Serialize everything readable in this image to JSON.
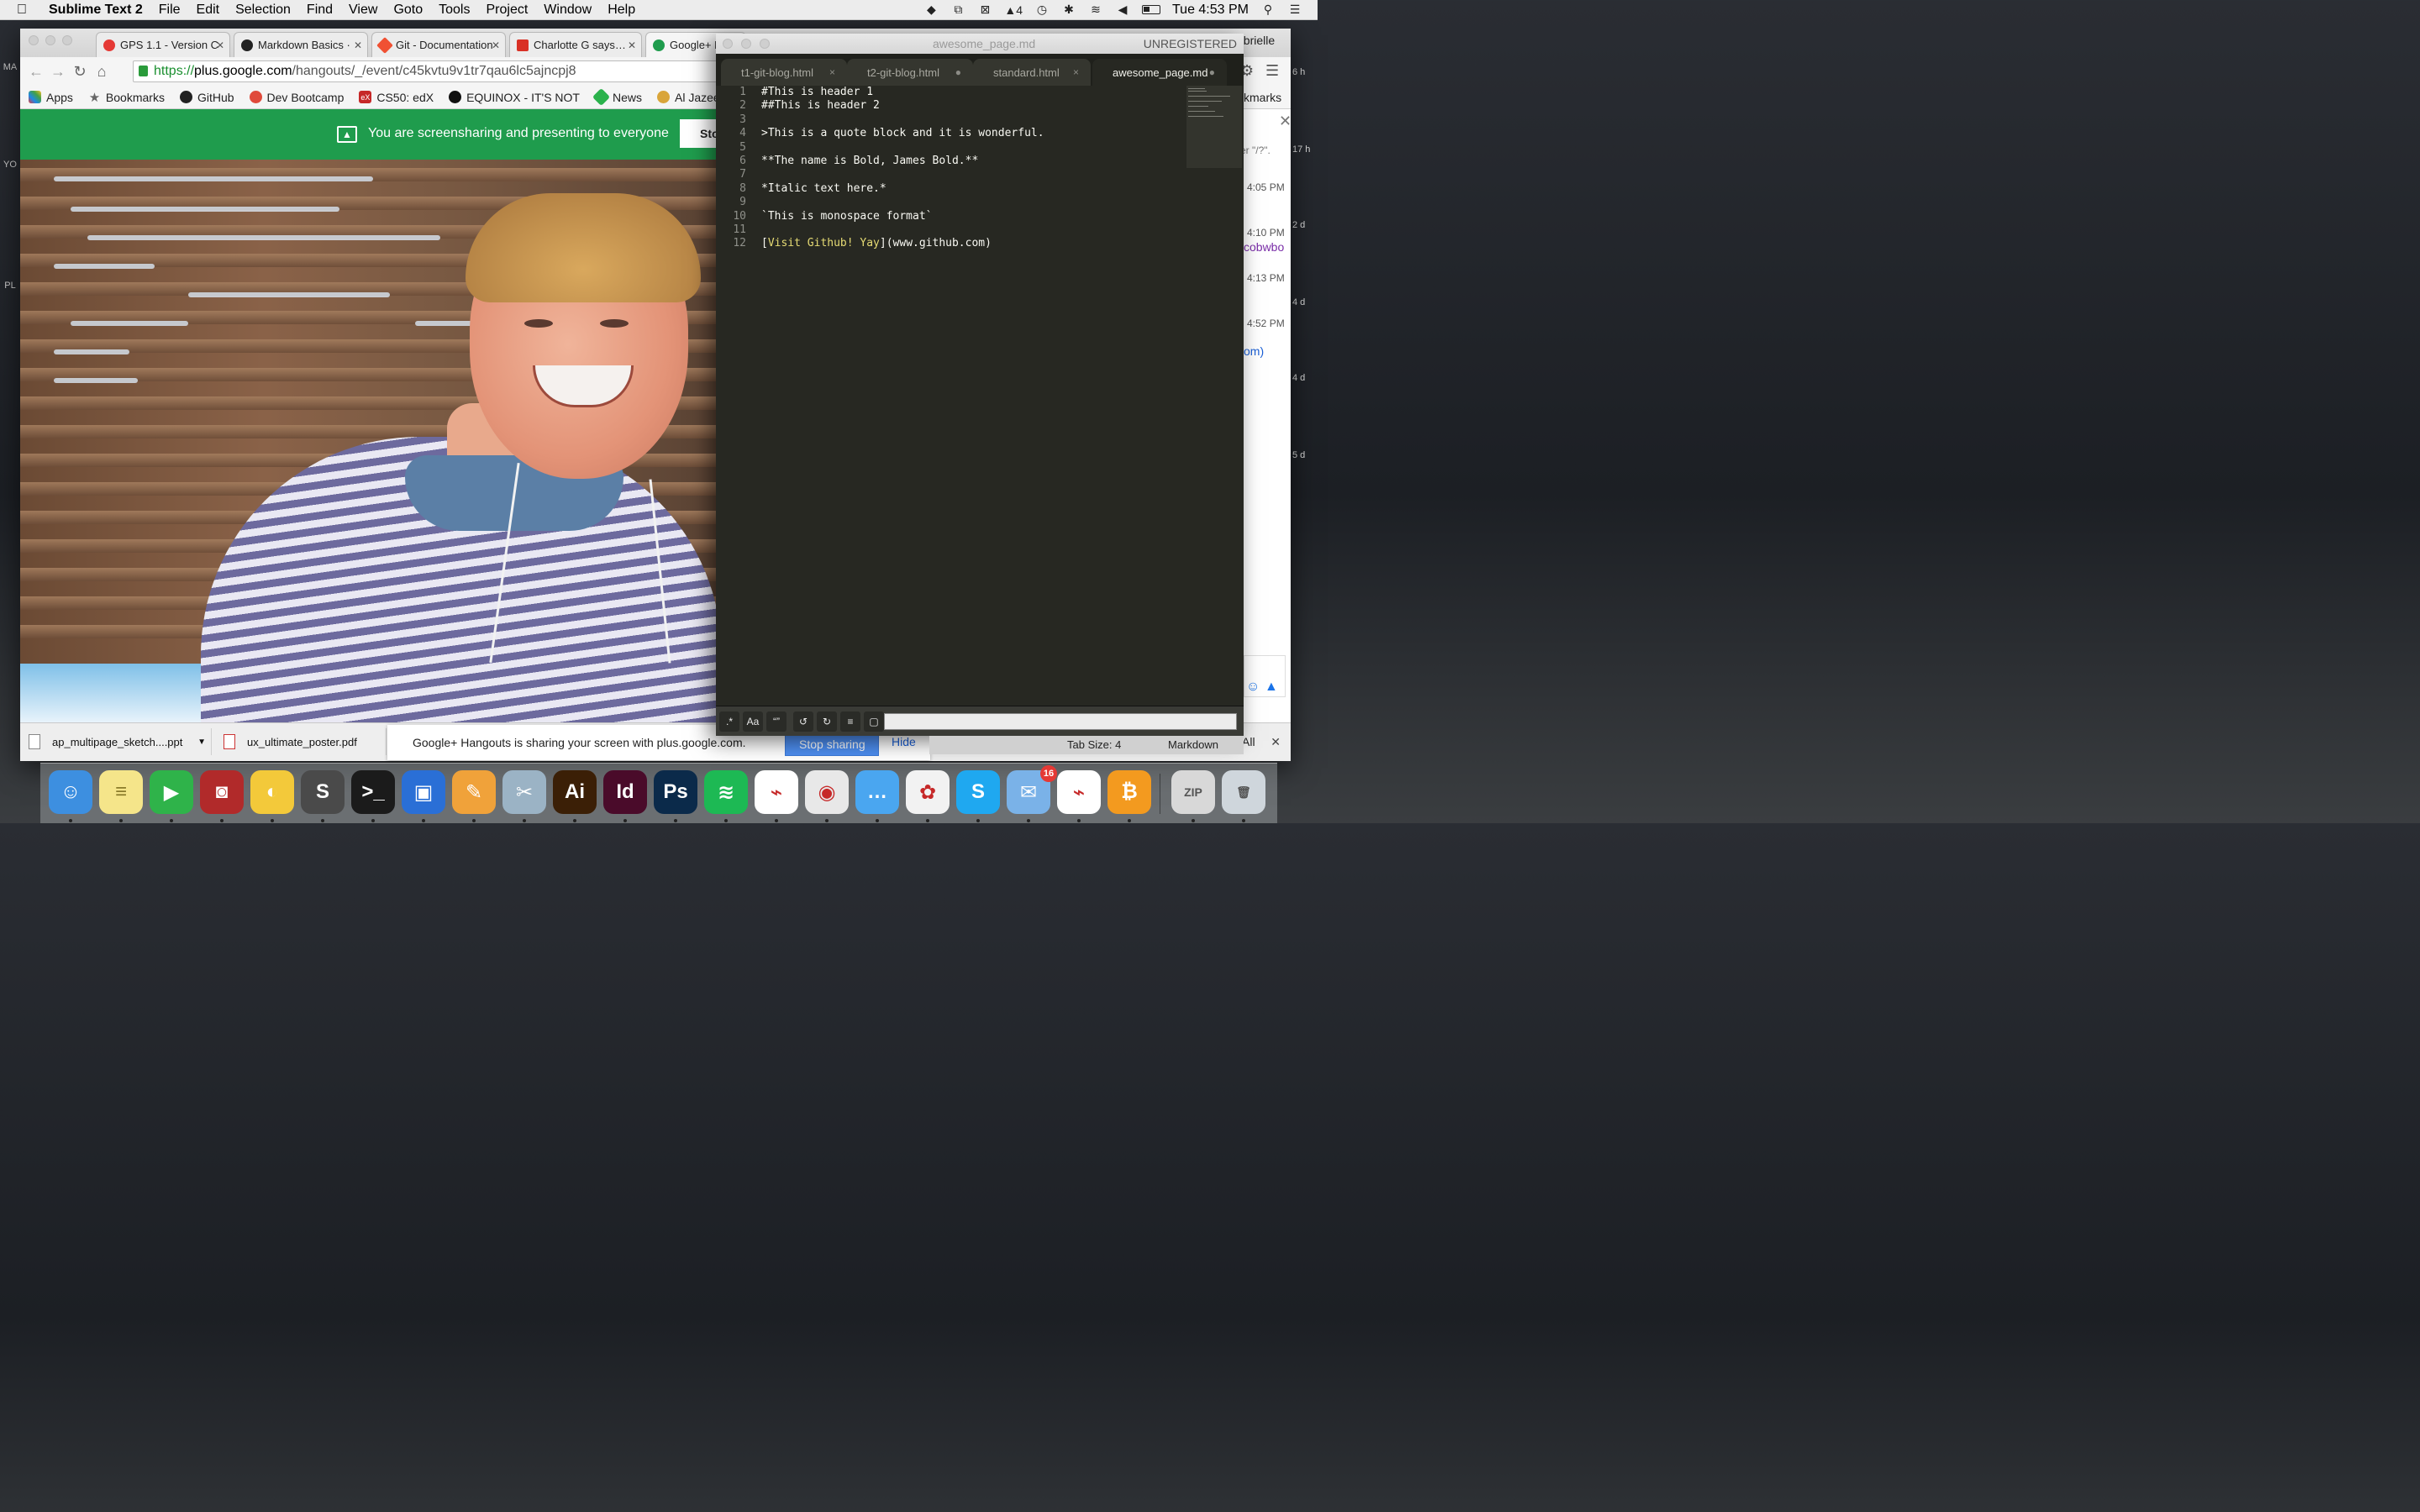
{
  "menubar": {
    "app_name": "Sublime Text 2",
    "items": [
      "File",
      "Edit",
      "Selection",
      "Find",
      "View",
      "Goto",
      "Tools",
      "Project",
      "Window",
      "Help"
    ],
    "adobe_count": "4",
    "clock": "Tue 4:53 PM"
  },
  "chrome": {
    "tabs": [
      {
        "label": "GPS 1.1 - Version C",
        "favicon_color": "#e53935"
      },
      {
        "label": "Markdown Basics ·",
        "favicon_color": "#222222"
      },
      {
        "label": "Git - Documentation",
        "favicon_color": "#f05133"
      },
      {
        "label": "Charlotte G says…",
        "favicon_color": "#d93025"
      },
      {
        "label": "Google+ H",
        "favicon_color": "#1f9c4d"
      }
    ],
    "profile_label": "abrielle",
    "url": {
      "scheme": "https://",
      "host": "plus.google.com",
      "path": "/hangouts/_/event/c45kvtu9v1tr7qau6lc5ajncpj8"
    },
    "bookmarks": [
      {
        "label": "Apps",
        "icon": "apps-grid-icon"
      },
      {
        "label": "Bookmarks",
        "icon": "star-icon"
      },
      {
        "label": "GitHub",
        "icon": "github-icon"
      },
      {
        "label": "Dev Bootcamp",
        "icon": "dbc-icon"
      },
      {
        "label": "CS50: edX",
        "icon": "edx-icon"
      },
      {
        "label": "EQUINOX - IT'S NOT",
        "icon": "equinox-icon"
      },
      {
        "label": "News",
        "icon": "feedly-icon"
      },
      {
        "label": "Al Jazeera",
        "icon": "aljazeera-icon"
      }
    ],
    "bookmarks_overflow": "kmarks",
    "share_bar": {
      "message": "You are screensharing and presenting to everyone",
      "stop_label": "Sto"
    },
    "chat": {
      "search_hint": "er \"/?\".",
      "times": [
        "4:05 PM",
        "4:10 PM",
        "4:13 PM",
        "4:52 PM"
      ],
      "link_fragment_1": "cobwbo",
      "link_fragment_2": "om)"
    },
    "downloads": [
      {
        "name": "ap_multipage_sketch....ppt"
      },
      {
        "name": "ux_ultimate_poster.pdf"
      }
    ],
    "hangout_notice": {
      "text": "Google+ Hangouts is sharing your screen with plus.google.com.",
      "stop_label": "Stop sharing",
      "hide_label": "Hide"
    },
    "downloads_all": "All"
  },
  "sublime": {
    "title": "awesome_page.md",
    "unregistered": "UNREGISTERED",
    "tabs": [
      {
        "label": "t1-git-blog.html",
        "mark": "×"
      },
      {
        "label": "t2-git-blog.html",
        "mark": "●"
      },
      {
        "label": "standard.html",
        "mark": "×"
      },
      {
        "label": "awesome_page.md",
        "mark": "●"
      }
    ],
    "line_numbers": [
      "1",
      "2",
      "3",
      "4",
      "5",
      "6",
      "7",
      "8",
      "9",
      "10",
      "11",
      "12"
    ],
    "lines": [
      "#This is header 1",
      "##This is header 2",
      "",
      ">This is a quote block and it is wonderful.",
      "",
      "**The name is Bold, James Bold.**",
      "",
      "*Italic text here.*",
      "",
      "`This is monospace format`",
      "",
      ""
    ],
    "link_line": {
      "open": "[",
      "text": "Visit Github! Yay",
      "rest": "](www.github.com)"
    },
    "find_buttons": [
      ".*",
      "Aa",
      "“”"
    ],
    "status": {
      "tab_size": "Tab Size: 4",
      "syntax": "Markdown"
    }
  },
  "edge_timeline": [
    "6 h",
    "17 h",
    "2 d",
    "4 d",
    "4 d",
    "5 d"
  ],
  "dock": {
    "apps": [
      {
        "name": "Finder",
        "color": "#3d8fe0",
        "glyph": "☺"
      },
      {
        "name": "Notes",
        "color": "#f5e58a",
        "glyph": "≡"
      },
      {
        "name": "FaceTime",
        "color": "#2fb34a",
        "glyph": "▶"
      },
      {
        "name": "Photo Booth",
        "color": "#b12a2a",
        "glyph": "◙"
      },
      {
        "name": "Cyberduck",
        "color": "#f3c93a",
        "glyph": "◐"
      },
      {
        "name": "Sublime Text",
        "color": "#4a4a4a",
        "glyph": "S"
      },
      {
        "name": "Terminal",
        "color": "#1b1b1b",
        "glyph": ">_"
      },
      {
        "name": "Screen Sharing",
        "color": "#2a6fd6",
        "glyph": "▣"
      },
      {
        "name": "Pages",
        "color": "#f0a23a",
        "glyph": "✎"
      },
      {
        "name": "Preview",
        "color": "#9bb3c5",
        "glyph": "✂"
      },
      {
        "name": "Illustrator",
        "color": "#3b1f06",
        "glyph": "Ai"
      },
      {
        "name": "InDesign",
        "color": "#4a0b2a",
        "glyph": "Id"
      },
      {
        "name": "Photoshop",
        "color": "#0b2a4a",
        "glyph": "Ps"
      },
      {
        "name": "Spotify",
        "color": "#1db954",
        "glyph": "≋"
      },
      {
        "name": "Acrobat",
        "color": "#ffffff",
        "glyph": "⌁"
      },
      {
        "name": "Chrome",
        "color": "#e8e8e8",
        "glyph": "◉"
      },
      {
        "name": "Messages",
        "color": "#4aa6f0",
        "glyph": "…"
      },
      {
        "name": "Photos",
        "color": "#f2f2f2",
        "glyph": "✿"
      },
      {
        "name": "Skype",
        "color": "#1fa8f0",
        "glyph": "S"
      },
      {
        "name": "Mail",
        "color": "#7ab2e8",
        "glyph": "✉",
        "badge": "16"
      },
      {
        "name": "Acrobat Reader",
        "color": "#ffffff",
        "glyph": "⌁"
      },
      {
        "name": "Bitcoin",
        "color": "#f39a1f",
        "glyph": "₿"
      },
      {
        "name": "Archive",
        "color": "#d8d8d8",
        "glyph": "ZIP"
      },
      {
        "name": "Trash",
        "color": "#cfd6dc",
        "glyph": "🗑"
      }
    ]
  }
}
